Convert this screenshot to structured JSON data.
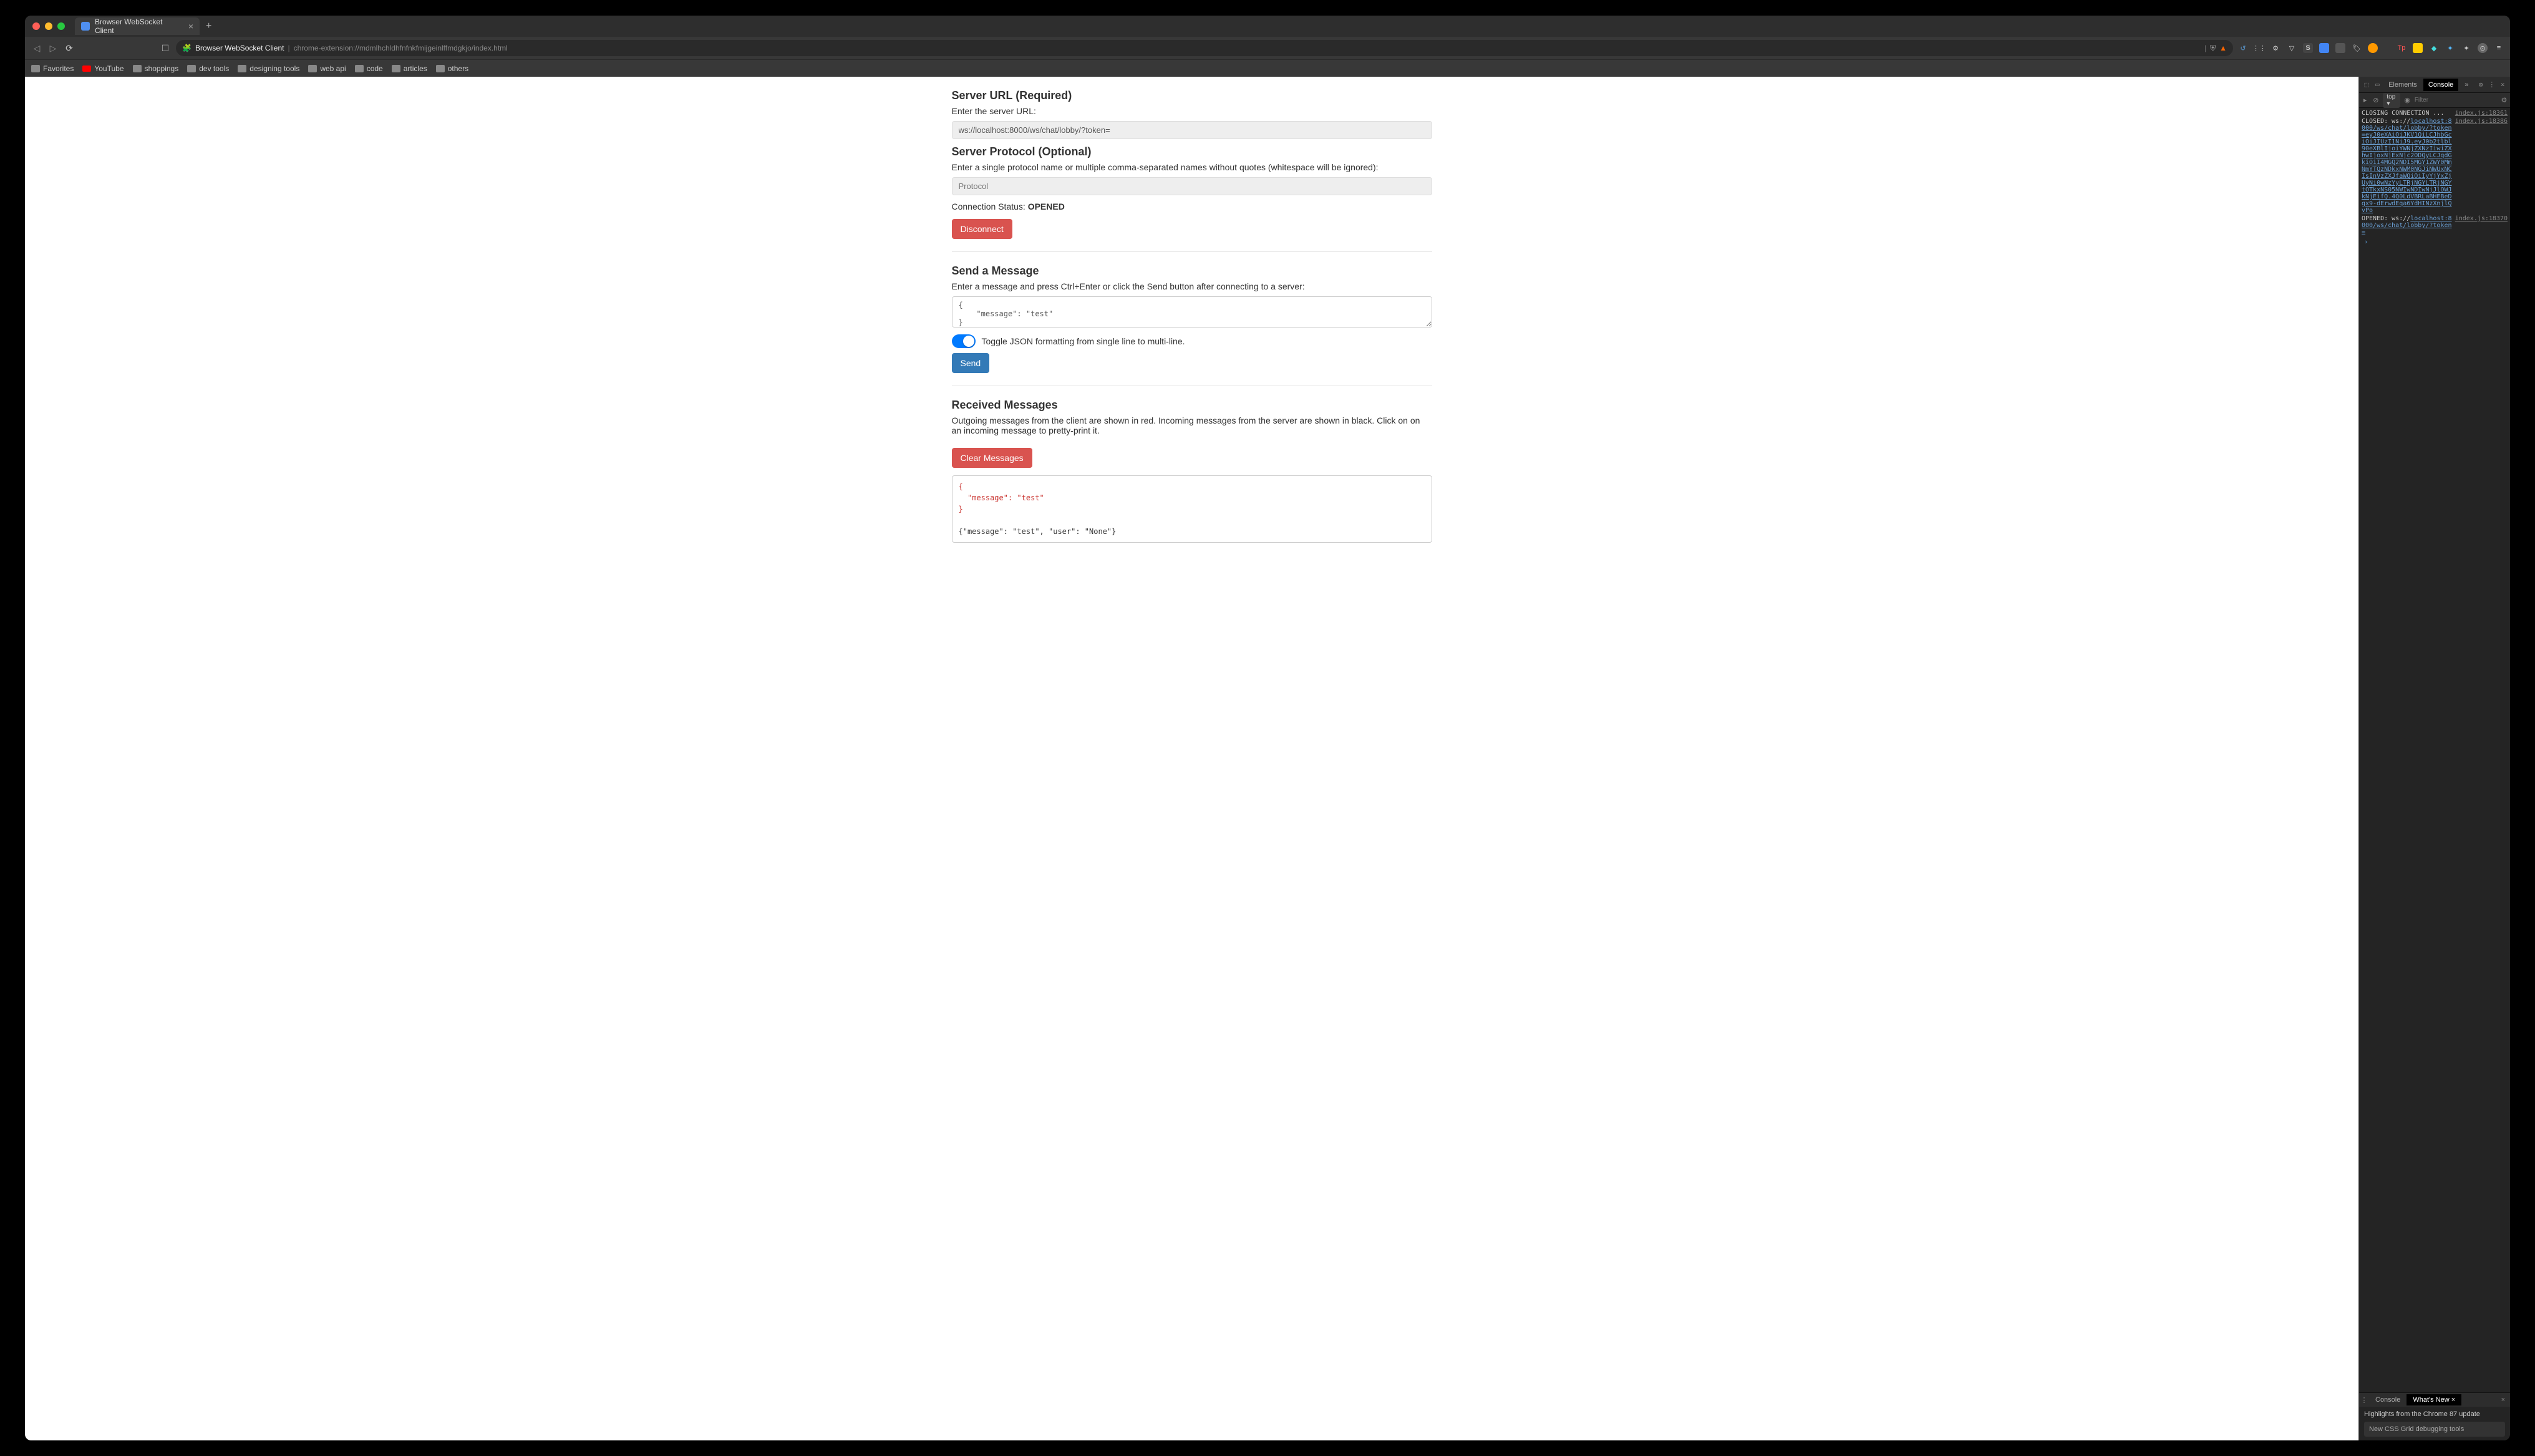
{
  "tab": {
    "title": "Browser WebSocket Client"
  },
  "address": {
    "ext_icon": "🧩",
    "ext_name": "Browser WebSocket Client",
    "url": "chrome-extension://mdmlhchldhfnfnkfmijgeinlffmdgkjo/index.html"
  },
  "bookmarks": [
    {
      "icon": "folder",
      "label": "Favorites"
    },
    {
      "icon": "youtube",
      "label": "YouTube"
    },
    {
      "icon": "folder",
      "label": "shoppings"
    },
    {
      "icon": "folder",
      "label": "dev tools"
    },
    {
      "icon": "folder",
      "label": "designing tools"
    },
    {
      "icon": "folder",
      "label": "web api"
    },
    {
      "icon": "folder",
      "label": "code"
    },
    {
      "icon": "folder",
      "label": "articles"
    },
    {
      "icon": "folder",
      "label": "others"
    }
  ],
  "server_url": {
    "title": "Server URL (Required)",
    "help": "Enter the server URL:",
    "value": "ws://localhost:8000/ws/chat/lobby/?token="
  },
  "server_protocol": {
    "title": "Server Protocol (Optional)",
    "help": "Enter a single protocol name or multiple comma-separated names without quotes (whitespace will be ignored):",
    "placeholder": "Protocol"
  },
  "connection": {
    "prefix": "Connection Status: ",
    "status": "OPENED",
    "disconnect_label": "Disconnect"
  },
  "send": {
    "title": "Send a Message",
    "help": "Enter a message and press Ctrl+Enter or click the Send button after connecting to a server:",
    "value": "{\n    \"message\": \"test\"\n}",
    "toggle_label": "Toggle JSON formatting from single line to multi-line.",
    "button_label": "Send"
  },
  "received": {
    "title": "Received Messages",
    "help": "Outgoing messages from the client are shown in red. Incoming messages from the server are shown in black. Click on on an incoming message to pretty-print it.",
    "clear_label": "Clear Messages",
    "outgoing": "{\n  \"message\": \"test\"\n}",
    "incoming": "{\"message\": \"test\", \"user\": \"None\"}"
  },
  "devtools": {
    "tabs": {
      "elements": "Elements",
      "console": "Console",
      "more": "»"
    },
    "toolbar": {
      "context": "top",
      "filter_placeholder": "Filter"
    },
    "log": [
      {
        "text_prefix": "CLOSING CONNECTION ...",
        "src": "index.js:18361"
      },
      {
        "text_prefix": "CLOSED: ws://",
        "link": "localhost:8000/ws/chat/lobby/?token=eyJ0eXAiOiJKV1QiLCJhbGciOiJIUzI1NiJ9.eyJ0b2tlbl90eXBlIjoiYWNjZXNzIiwiZXhwIjoxNjExNjc2ODQyLCJqdGkiOiI4MGQ2NDI5MGY1ZWY0MmNmYTQzNDkxNWM0NGJiNWUxNCIsInVzZXJfaWQiOiIyYjYxZjUyNi0wNzYyLTRjNGYLTRjNGYtOTkxNS05NWIwNDIwNjJlOWJkNjEifQ.4Q0LdVBRLaBHEBeDgx9-dErwdEqa6YdHINzXnjlQvPo",
        "src": "index.js:18386"
      },
      {
        "text_prefix": "OPENED: ws://",
        "link": "localhost:8000/ws/chat/lobby/?token=",
        "src": "index.js:18370"
      }
    ],
    "drawer": {
      "tabs": {
        "console": "Console",
        "whatsnew": "What's New"
      },
      "highlight": "Highlights from the Chrome 87 update",
      "card": "New CSS Grid debugging tools"
    }
  }
}
